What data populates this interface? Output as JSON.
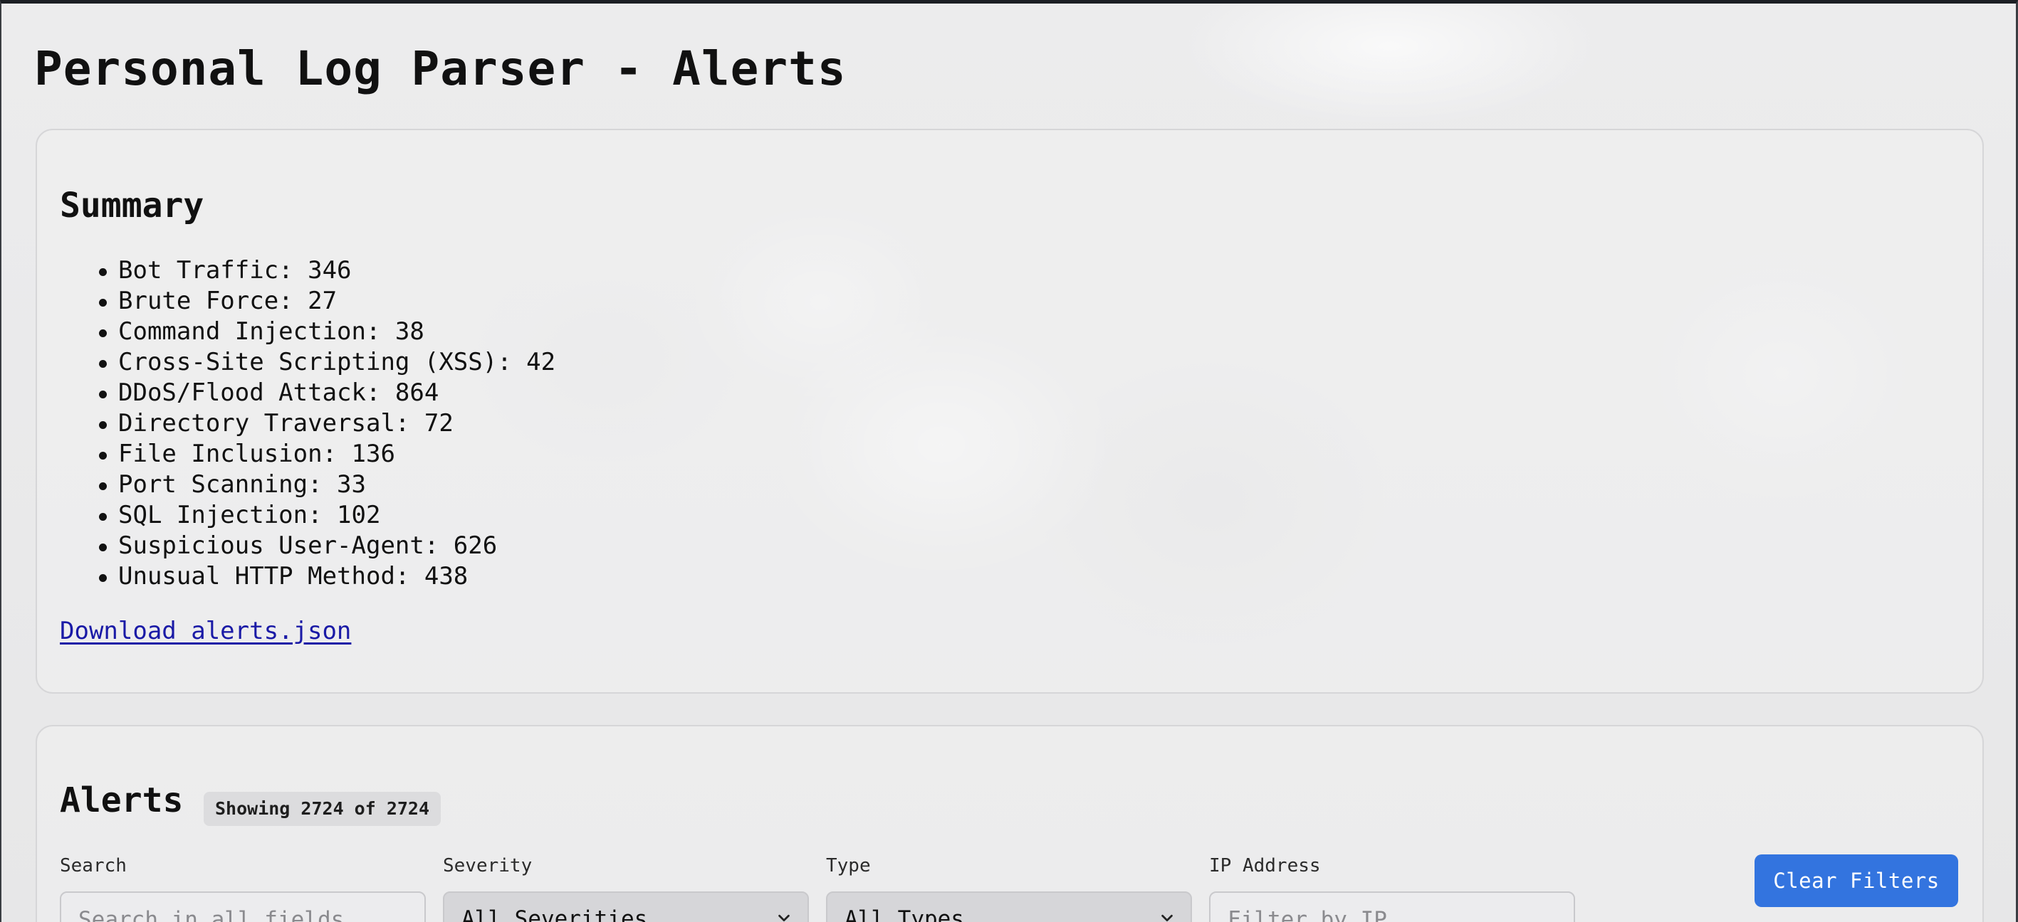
{
  "page": {
    "title": "Personal Log Parser - Alerts"
  },
  "summary": {
    "heading": "Summary",
    "items": [
      {
        "label": "Bot Traffic: 346"
      },
      {
        "label": "Brute Force: 27"
      },
      {
        "label": "Command Injection: 38"
      },
      {
        "label": "Cross-Site Scripting (XSS): 42"
      },
      {
        "label": "DDoS/Flood Attack: 864"
      },
      {
        "label": "Directory Traversal: 72"
      },
      {
        "label": "File Inclusion: 136"
      },
      {
        "label": "Port Scanning: 33"
      },
      {
        "label": "SQL Injection: 102"
      },
      {
        "label": "Suspicious User-Agent: 626"
      },
      {
        "label": "Unusual HTTP Method: 438"
      }
    ],
    "download_link": "Download alerts.json"
  },
  "alerts": {
    "heading": "Alerts",
    "count_badge": "Showing 2724 of 2724",
    "filters": {
      "search_label": "Search",
      "search_placeholder": "Search in all fields...",
      "severity_label": "Severity",
      "severity_selected": "All Severities",
      "type_label": "Type",
      "type_selected": "All Types",
      "ip_label": "IP Address",
      "ip_placeholder": "Filter by IP..."
    },
    "clear_button": "Clear Filters"
  },
  "colors": {
    "accent_button": "#3374df",
    "link": "#1a1aa6",
    "card_border": "#d6d6d8"
  },
  "icons": {
    "select_chevron": "chevron-down-icon"
  }
}
